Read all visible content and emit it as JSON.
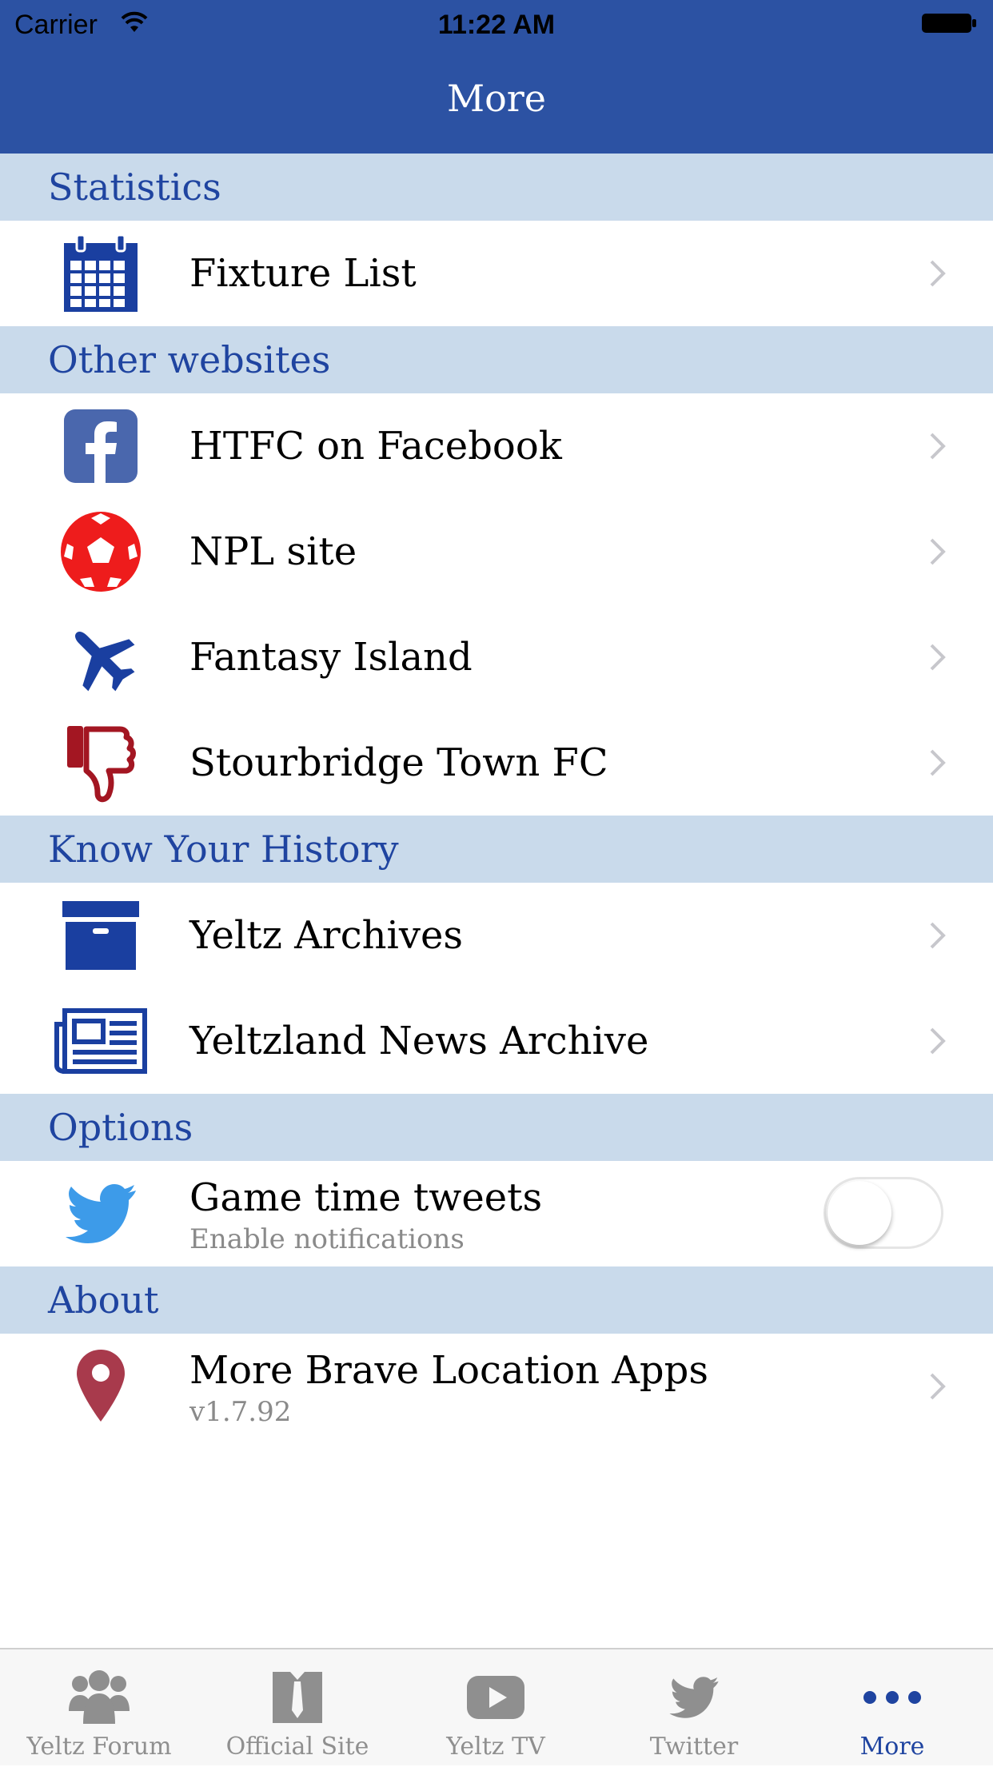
{
  "status_bar": {
    "carrier": "Carrier",
    "time": "11:22 AM"
  },
  "nav": {
    "title": "More"
  },
  "sections": [
    {
      "header": "Statistics",
      "rows": [
        {
          "title": "Fixture List",
          "icon": "calendar-icon"
        }
      ]
    },
    {
      "header": "Other websites",
      "rows": [
        {
          "title": "HTFC on Facebook",
          "icon": "facebook-icon"
        },
        {
          "title": "NPL site",
          "icon": "soccer-ball-icon"
        },
        {
          "title": "Fantasy Island",
          "icon": "airplane-icon"
        },
        {
          "title": "Stourbridge Town FC",
          "icon": "thumbs-down-icon"
        }
      ]
    },
    {
      "header": "Know Your History",
      "rows": [
        {
          "title": "Yeltz Archives",
          "icon": "archive-box-icon"
        },
        {
          "title": "Yeltzland News Archive",
          "icon": "newspaper-icon"
        }
      ]
    },
    {
      "header": "Options",
      "rows": [
        {
          "title": "Game time tweets",
          "subtitle": "Enable notifications",
          "icon": "twitter-bird-icon",
          "toggle_on": false
        }
      ]
    },
    {
      "header": "About",
      "rows": [
        {
          "title": "More Brave Location Apps",
          "subtitle": "v1.7.92",
          "icon": "map-pin-icon"
        }
      ]
    }
  ],
  "tabs": [
    {
      "label": "Yeltz Forum",
      "icon": "group-icon"
    },
    {
      "label": "Official Site",
      "icon": "shirt-tie-icon"
    },
    {
      "label": "Yeltz TV",
      "icon": "play-icon"
    },
    {
      "label": "Twitter",
      "icon": "twitter-bird-icon"
    },
    {
      "label": "More",
      "icon": "more-dots-icon",
      "active": true
    }
  ],
  "colors": {
    "nav_blue": "#2c52a3",
    "section_bg": "#c9daeb",
    "section_text": "#1f44a0",
    "calendar_blue": "#1a3fa0",
    "facebook_blue": "#4a67ad",
    "ball_red": "#ee1c1c",
    "thumb_red": "#a31622",
    "twitter_blue": "#3d9be9",
    "pin_red": "#a83a4c",
    "tab_gray": "#8f8f8f"
  }
}
